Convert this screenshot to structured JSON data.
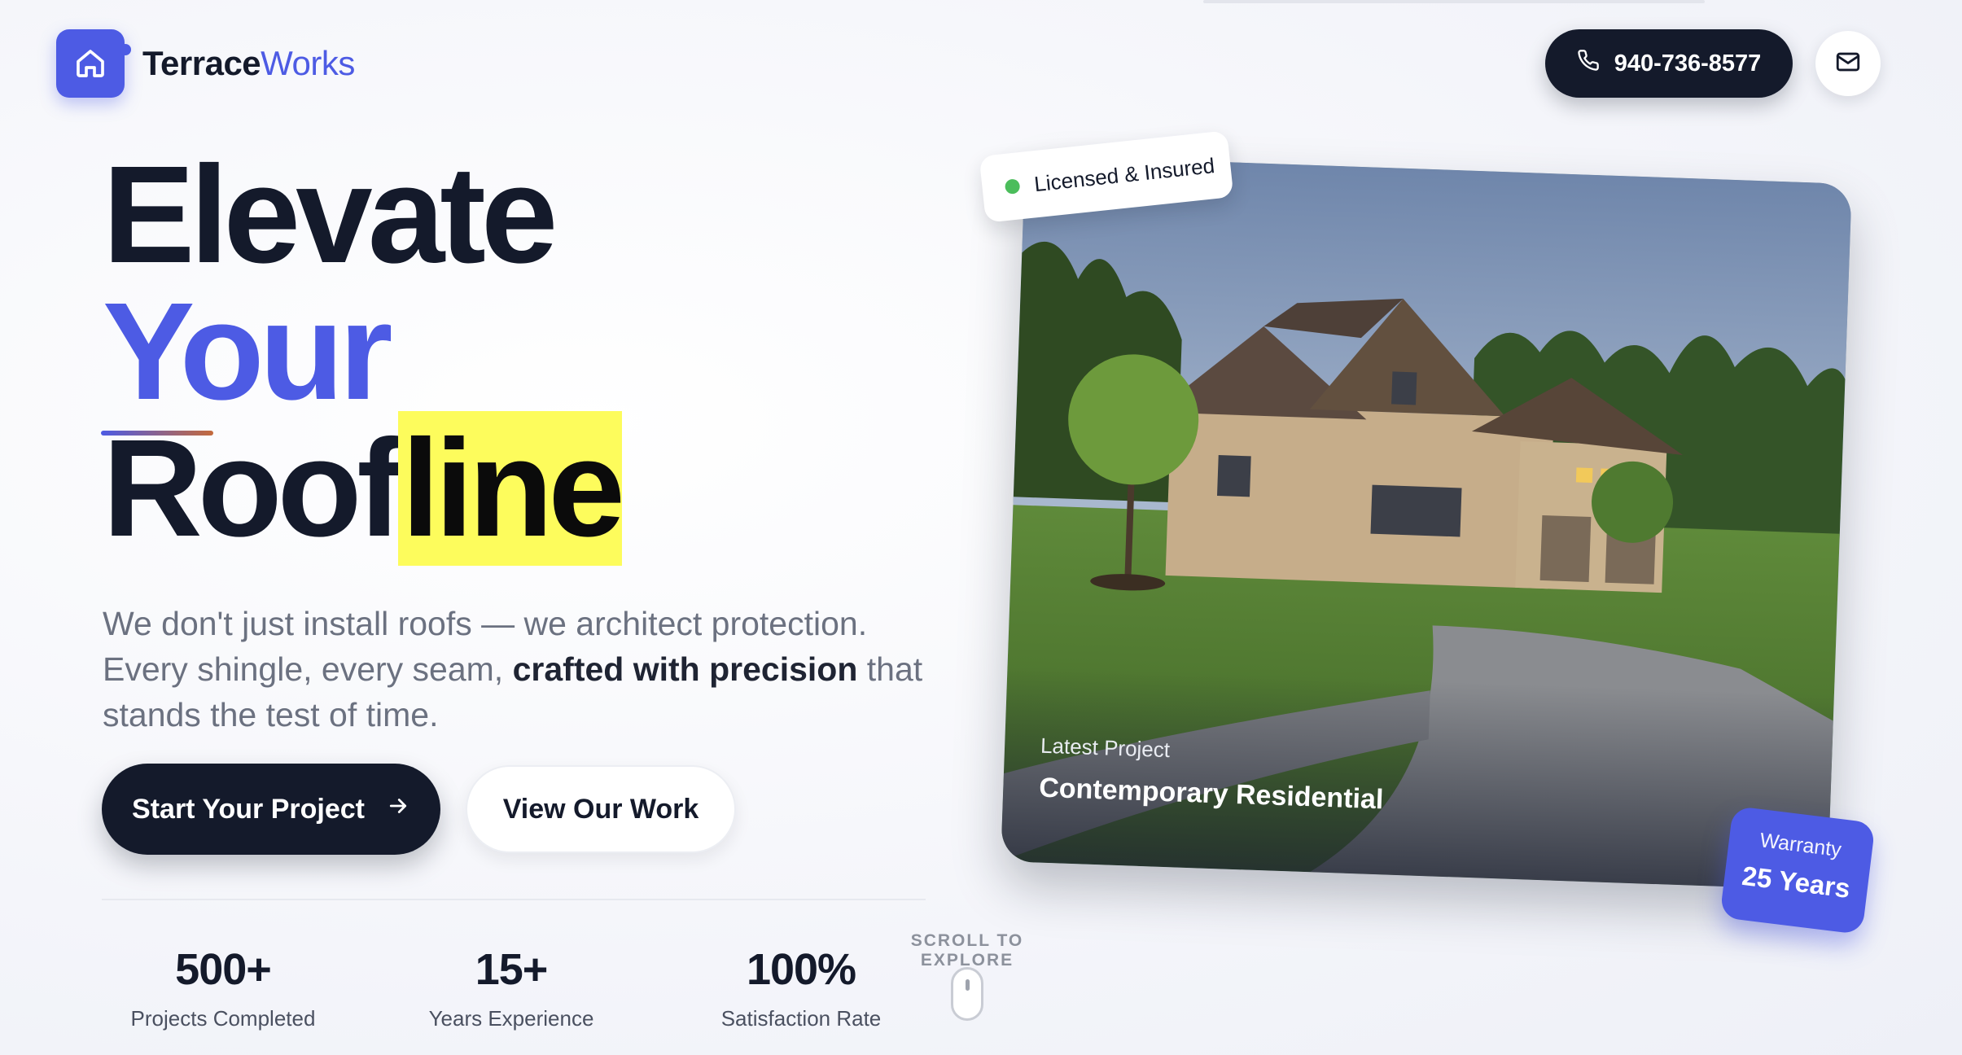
{
  "header": {
    "brand_bold": "Terrace",
    "brand_light": "Works",
    "phone": "940-736-8577"
  },
  "hero": {
    "line1": "Elevate",
    "line2": "Your",
    "line3_plain": "Roof",
    "line3_highlight": "line",
    "subcopy_part1": "We don't just install roofs — we architect protection. Every shingle, every seam,",
    "subcopy_bold": "crafted with precision",
    "subcopy_part2": "that stands the test of time.",
    "primary_cta": "Start Your Project",
    "secondary_cta": "View Our Work"
  },
  "stats": [
    {
      "value": "500+",
      "label": "Projects Completed"
    },
    {
      "value": "15+",
      "label": "Years Experience"
    },
    {
      "value": "100%",
      "label": "Satisfaction Rate"
    }
  ],
  "scroll_hint": "SCROLL TO EXPLORE",
  "project_card": {
    "badge": "Licensed & Insured",
    "eyebrow": "Latest Project",
    "title": "Contemporary Residential",
    "warranty_label": "Warranty",
    "warranty_value": "25 Years"
  },
  "colors": {
    "accent": "#4d5be4",
    "dark": "#141a2b",
    "highlight": "#fdfc5c",
    "status_green": "#4bbd5b"
  },
  "icons": {
    "logo": "home-icon",
    "phone": "phone-icon",
    "mail": "mail-icon",
    "arrow": "arrow-right-icon"
  }
}
